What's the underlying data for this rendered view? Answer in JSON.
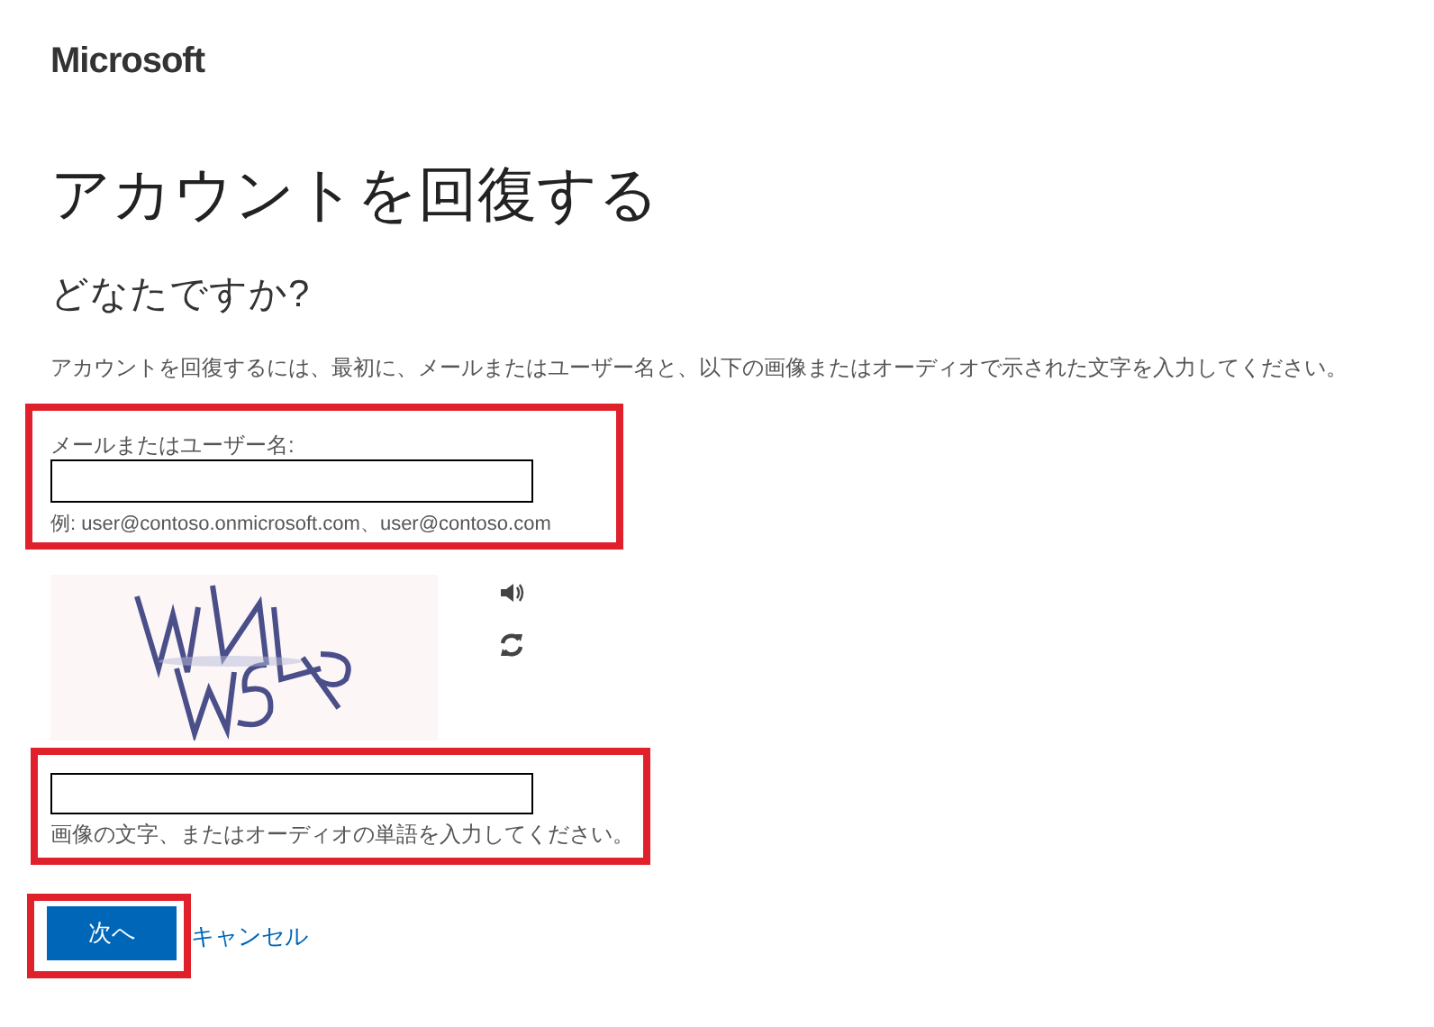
{
  "logo": "Microsoft",
  "title": "アカウントを回復する",
  "subtitle": "どなたですか?",
  "intro": "アカウントを回復するには、最初に、メールまたはユーザー名と、以下の画像またはオーディオで示された文字を入力してください。",
  "account_field": {
    "label": "メールまたはユーザー名:",
    "hint": "例: user@contoso.onmicrosoft.com、user@contoso.com"
  },
  "captcha_field": {
    "hint": "画像の文字、またはオーディオの単語を入力してください。"
  },
  "buttons": [
    {
      "label": "次へ",
      "kind": "primary"
    },
    {
      "label": "キャンセル",
      "kind": "link"
    }
  ]
}
